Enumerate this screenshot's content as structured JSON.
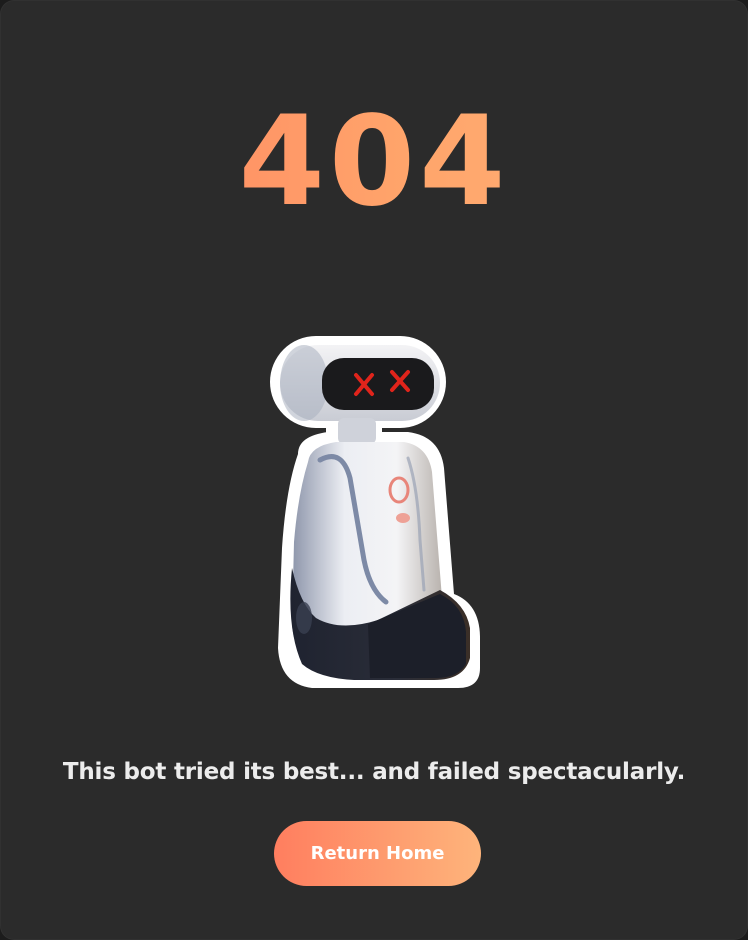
{
  "error": {
    "code": "404",
    "message": "This bot tried its best... and failed spectacularly."
  },
  "actions": {
    "return_home_label": "Return Home"
  },
  "illustration": {
    "icon": "broken-robot-icon",
    "eyes": "x-eyes"
  },
  "colors": {
    "background": "#2b2b2b",
    "gradient_start": "#ff7e5f",
    "gradient_end": "#feb47b",
    "text": "#ececec",
    "eye_red": "#e0241b"
  }
}
